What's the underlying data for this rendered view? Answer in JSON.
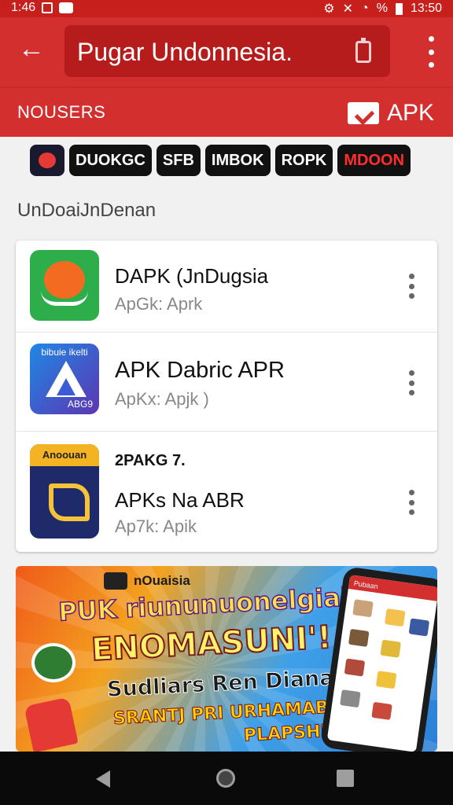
{
  "status_bar": {
    "time_left": "1:46",
    "battery_percent": "%",
    "time_right": "13:50"
  },
  "app_bar": {
    "search_text": "Pugar Undonnesia."
  },
  "sub_bar": {
    "title": "NOUSERS",
    "apk_label": "APK"
  },
  "chips": [
    "DUOKGC",
    "SFB",
    "IMBOK",
    "ROPK",
    "MDOON"
  ],
  "section_title": "UnDoaiJnDenan",
  "apps": [
    {
      "name": "DAPK (JnDugsia",
      "subtitle": "ApGk: Aprk"
    },
    {
      "icon_caption": "bibuie ikelti",
      "icon_badge": "ABG9",
      "name": "APK Dabric APR",
      "subtitle": "ApKx: Apjk  )"
    },
    {
      "icon_caption": "Anoouan",
      "tag": "2PAKG 7.",
      "name": "APKs Na ABR",
      "subtitle": "Ap7k: Apik"
    }
  ],
  "banner": {
    "tag": "nOuaisia",
    "line1": "PUK riununuonelgiai",
    "line2": "ENOMASUNI'!",
    "line3": "Sudliars Ren Dianan",
    "line4": "SRANTJ PRI URHAMABON",
    "line5": "PLAPSHINI",
    "phone_header": "Pubaan"
  },
  "colors": {
    "primary_red": "#d32f2f",
    "status_red": "#c61f1c",
    "chip_bg": "#111111"
  }
}
